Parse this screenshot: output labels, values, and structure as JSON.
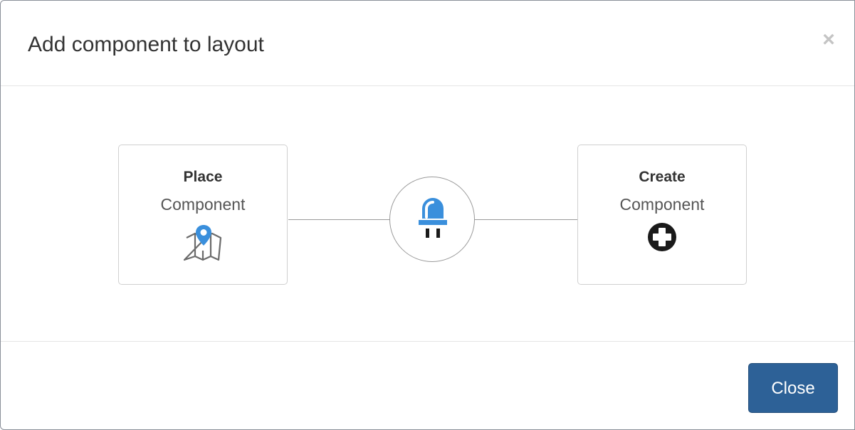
{
  "dialog": {
    "title": "Add component to layout",
    "close_symbol": "×"
  },
  "options": {
    "place": {
      "title": "Place",
      "subtitle": "Component",
      "icon": "map-marker-icon"
    },
    "create": {
      "title": "Create",
      "subtitle": "Component",
      "icon": "plus-circle-icon"
    }
  },
  "hub": {
    "icon": "led-plug-icon"
  },
  "footer": {
    "close_label": "Close"
  },
  "colors": {
    "accent_blue": "#3a8fdc",
    "button_bg": "#2d6197",
    "icon_dark": "#1a1a1a"
  }
}
